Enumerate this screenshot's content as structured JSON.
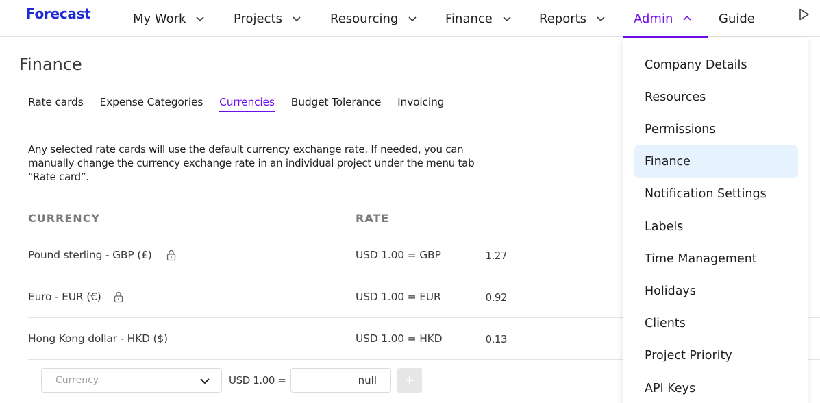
{
  "app": {
    "logo": "Forecast"
  },
  "nav": {
    "items": [
      {
        "label": "My Work"
      },
      {
        "label": "Projects"
      },
      {
        "label": "Resourcing"
      },
      {
        "label": "Finance"
      },
      {
        "label": "Reports"
      },
      {
        "label": "Admin"
      },
      {
        "label": "Guide"
      }
    ],
    "active": "Admin"
  },
  "page": {
    "title": "Finance",
    "tabs": [
      {
        "label": "Rate cards"
      },
      {
        "label": "Expense Categories"
      },
      {
        "label": "Currencies"
      },
      {
        "label": "Budget Tolerance"
      },
      {
        "label": "Invoicing"
      }
    ],
    "active_tab": "Currencies",
    "description": "Any selected rate cards will use the default currency exchange rate. If needed, you can manually change the currency exchange rate in an individual project under the menu tab “Rate card”."
  },
  "table": {
    "headers": {
      "currency": "CURRENCY",
      "rate": "RATE"
    },
    "rows": [
      {
        "currency": "Pound sterling - GBP (£)",
        "rate_label": "USD 1.00 = GBP",
        "rate": "1.27",
        "locked": true
      },
      {
        "currency": "Euro - EUR (€)",
        "rate_label": "USD 1.00 = EUR",
        "rate": "0.92",
        "locked": true
      },
      {
        "currency": "Hong Kong dollar - HKD ($)",
        "rate_label": "USD 1.00 = HKD",
        "rate": "0.13",
        "locked": false
      }
    ]
  },
  "add_row": {
    "select_placeholder": "Currency",
    "usd_label": "USD 1.00 =",
    "rate_value": "null"
  },
  "admin_menu": {
    "items": [
      {
        "label": "Company Details"
      },
      {
        "label": "Resources"
      },
      {
        "label": "Permissions"
      },
      {
        "label": "Finance"
      },
      {
        "label": "Notification Settings"
      },
      {
        "label": "Labels"
      },
      {
        "label": "Time Management"
      },
      {
        "label": "Holidays"
      },
      {
        "label": "Clients"
      },
      {
        "label": "Project Priority"
      },
      {
        "label": "API Keys"
      }
    ],
    "selected": "Finance"
  },
  "colors": {
    "brand": "#1d2bd4",
    "accent": "#6e0fea",
    "menu_selected_bg": "#e6f2fd"
  },
  "icons": {
    "nav_chevron": "chevron-down-icon",
    "admin_chevron": "chevron-up-icon",
    "guide_play": "play-icon",
    "row_lock": "lock-icon",
    "select_chevron": "chevron-down-icon",
    "add": "plus-icon"
  }
}
